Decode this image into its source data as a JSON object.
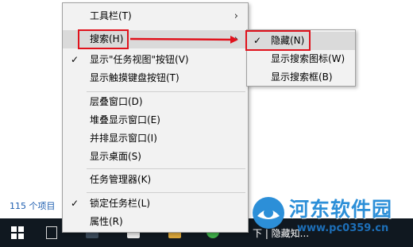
{
  "status_bar": {
    "item_count": "115 个项目"
  },
  "context_menu": {
    "items": [
      {
        "label": "工具栏(T)",
        "checked": false,
        "submenu": true
      },
      {
        "label": "搜索(H)",
        "checked": false,
        "submenu": true
      },
      {
        "label": "显示\"任务视图\"按钮(V)",
        "checked": true,
        "submenu": false
      },
      {
        "label": "显示触摸键盘按钮(T)",
        "checked": false,
        "submenu": false
      },
      {
        "label": "层叠窗口(D)",
        "checked": false,
        "submenu": false
      },
      {
        "label": "堆叠显示窗口(E)",
        "checked": false,
        "submenu": false
      },
      {
        "label": "并排显示窗口(I)",
        "checked": false,
        "submenu": false
      },
      {
        "label": "显示桌面(S)",
        "checked": false,
        "submenu": false
      },
      {
        "label": "任务管理器(K)",
        "checked": false,
        "submenu": false
      },
      {
        "label": "锁定任务栏(L)",
        "checked": true,
        "submenu": false
      },
      {
        "label": "属性(R)",
        "checked": false,
        "submenu": false
      }
    ]
  },
  "search_submenu": {
    "items": [
      {
        "label": "隐藏(N)",
        "checked": true
      },
      {
        "label": "显示搜索图标(W)",
        "checked": false
      },
      {
        "label": "显示搜索框(B)",
        "checked": false
      }
    ]
  },
  "icons": {
    "check": "✓",
    "submenu_arrow": "›",
    "start": "windows-logo-icon",
    "task_view": "task-view-icon"
  },
  "taskbar": {
    "tray_text": "下 | 隐藏知..."
  },
  "watermark": {
    "title": "河东软件园",
    "url": "www.pc0359.cn"
  },
  "colors": {
    "highlight": "#e0121c",
    "menu_bg": "#f2f2f2",
    "menu_hover": "#dadada",
    "taskbar": "#101820",
    "watermark_blue": "#2c8fd8"
  }
}
